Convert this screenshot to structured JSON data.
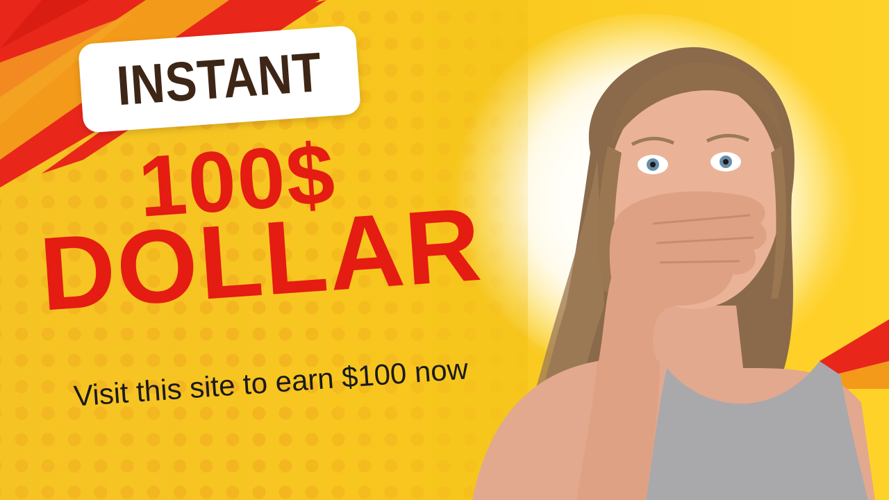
{
  "badge": {
    "label": "INSTANT"
  },
  "headline": {
    "amount": "100$",
    "currency_word": "DOLLAR"
  },
  "cta": {
    "text": "Visit this site to earn $100 now"
  },
  "colors": {
    "background": "#f6c51c",
    "accent_red": "#e41c12",
    "badge_text": "#3d2616",
    "stripe_orange": "#f39a1a"
  },
  "image": {
    "subject": "surprised woman covering mouth with hand"
  }
}
